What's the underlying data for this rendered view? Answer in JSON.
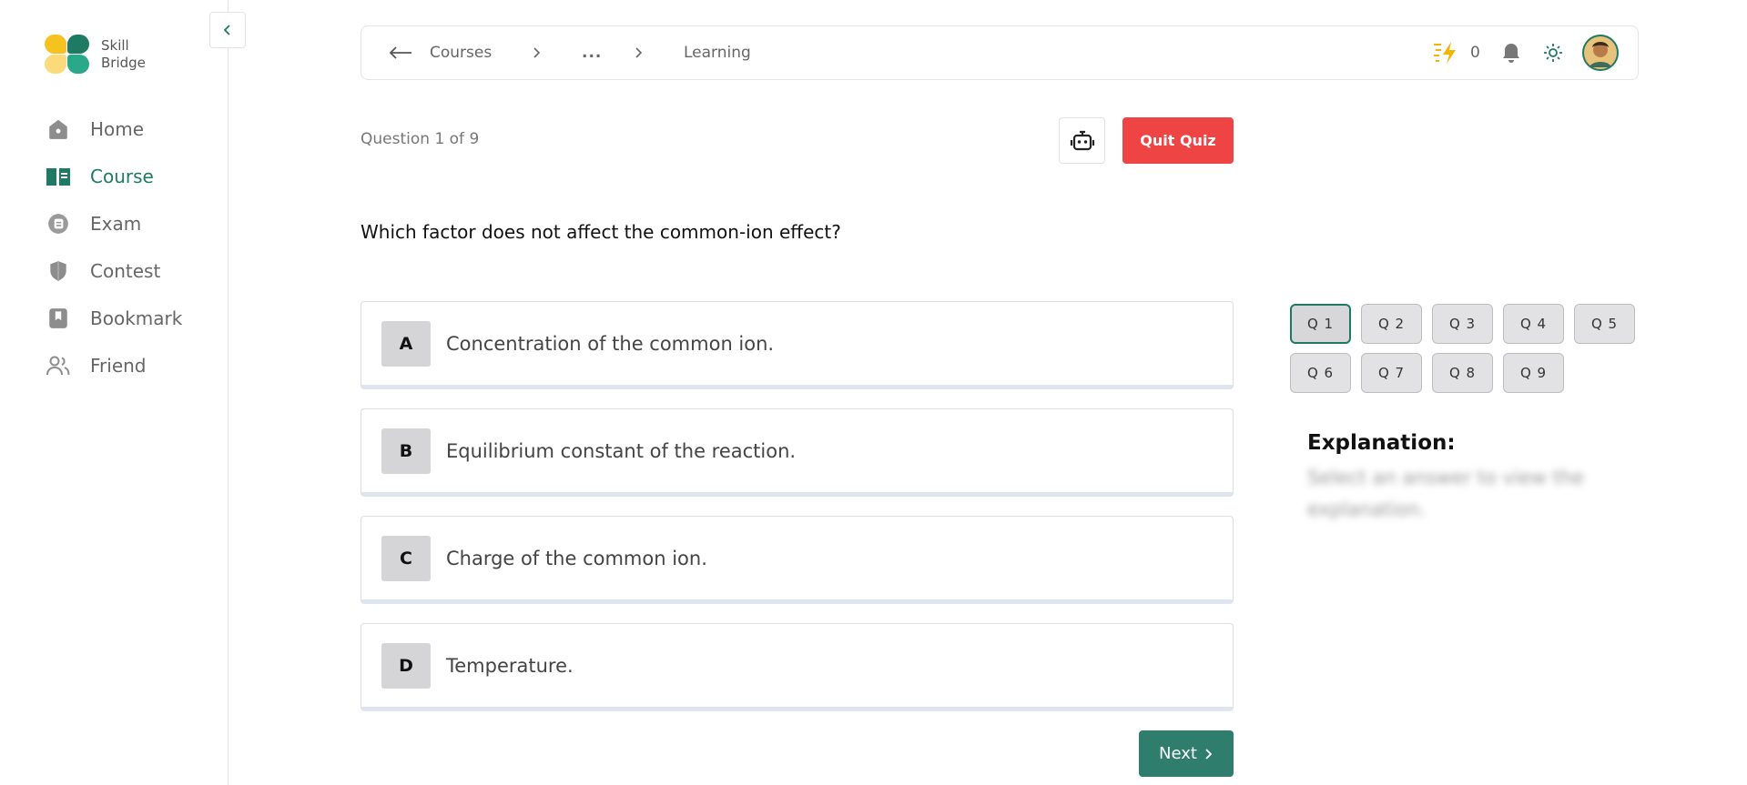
{
  "app": {
    "logo_line1": "Skill",
    "logo_line2": "Bridge",
    "brand_color": "#1e7a63"
  },
  "sidebar": {
    "collapse_icon": "chevron-left-icon",
    "items": [
      {
        "label": "Home",
        "icon": "home-icon",
        "active": false
      },
      {
        "label": "Course",
        "icon": "book-icon",
        "active": true
      },
      {
        "label": "Exam",
        "icon": "exam-icon",
        "active": false
      },
      {
        "label": "Contest",
        "icon": "contest-icon",
        "active": false
      },
      {
        "label": "Bookmark",
        "icon": "bookmark-icon",
        "active": false
      },
      {
        "label": "Friend",
        "icon": "users-icon",
        "active": false
      }
    ]
  },
  "topbar": {
    "breadcrumb": [
      "Courses",
      "...",
      "Learning"
    ],
    "streak_count": "0",
    "icons": [
      "back-arrow-icon",
      "streak-icon",
      "bell-icon",
      "sun-icon",
      "avatar"
    ]
  },
  "quiz": {
    "progress": "Question 1 of 9",
    "quit_label": "Quit Quiz",
    "question": "Which factor does not affect the common-ion effect?",
    "options": [
      {
        "letter": "A",
        "text": "Concentration of the common ion."
      },
      {
        "letter": "B",
        "text": "Equilibrium constant of the reaction."
      },
      {
        "letter": "C",
        "text": "Charge of the common ion."
      },
      {
        "letter": "D",
        "text": "Temperature."
      }
    ],
    "next_label": "Next",
    "question_nav": [
      "Q 1",
      "Q 2",
      "Q 3",
      "Q 4",
      "Q 5",
      "Q 6",
      "Q 7",
      "Q 8",
      "Q 9"
    ],
    "current_question": "Q 1",
    "explanation_title": "Explanation:",
    "explanation_text": "Select an answer to view the explanation."
  },
  "colors": {
    "quit": "#ef4444",
    "next": "#2e7d6d",
    "streak": "#f4b400"
  }
}
